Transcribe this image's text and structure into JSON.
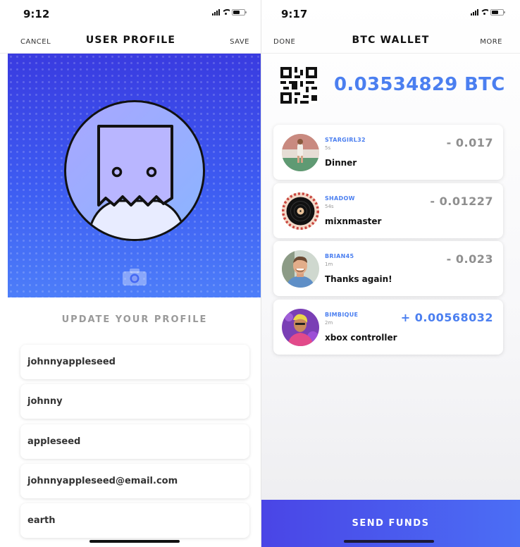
{
  "left": {
    "status": {
      "time": "9:12"
    },
    "nav": {
      "cancel": "CANCEL",
      "title": "USER PROFILE",
      "save": "SAVE"
    },
    "avatar_icon": "paper-bag-face-icon",
    "camera_icon": "camera-icon",
    "section_title": "UPDATE YOUR PROFILE",
    "fields": [
      {
        "value": "johnnyappleseed"
      },
      {
        "value": "johnny"
      },
      {
        "value": "appleseed"
      },
      {
        "value": "johnnyappleseed@email.com"
      },
      {
        "value": "earth"
      }
    ]
  },
  "right": {
    "status": {
      "time": "9:17"
    },
    "nav": {
      "done": "DONE",
      "title": "BTC WALLET",
      "more": "MORE"
    },
    "qr_icon": "qr-code-icon",
    "balance": "0.03534829 BTC",
    "transactions": [
      {
        "user": "STARGIRL32",
        "time": "5s",
        "memo": "Dinner",
        "amount": "- 0.017",
        "direction": "out"
      },
      {
        "user": "SHADOW",
        "time": "54s",
        "memo": "mixnmaster",
        "amount": "- 0.01227",
        "direction": "out"
      },
      {
        "user": "BRIAN45",
        "time": "1m",
        "memo": "Thanks again!",
        "amount": "- 0.023",
        "direction": "out"
      },
      {
        "user": "BIMBIQUE",
        "time": "2m",
        "memo": "xbox controller",
        "amount": "+ 0.00568032",
        "direction": "in"
      }
    ],
    "send_button": "SEND FUNDS"
  },
  "colors": {
    "accent_blue": "#4b7ff0",
    "hero_gradient_top": "#3a3be0",
    "hero_gradient_bottom": "#4d7ef9",
    "negative_amount": "#8f8f8f"
  }
}
